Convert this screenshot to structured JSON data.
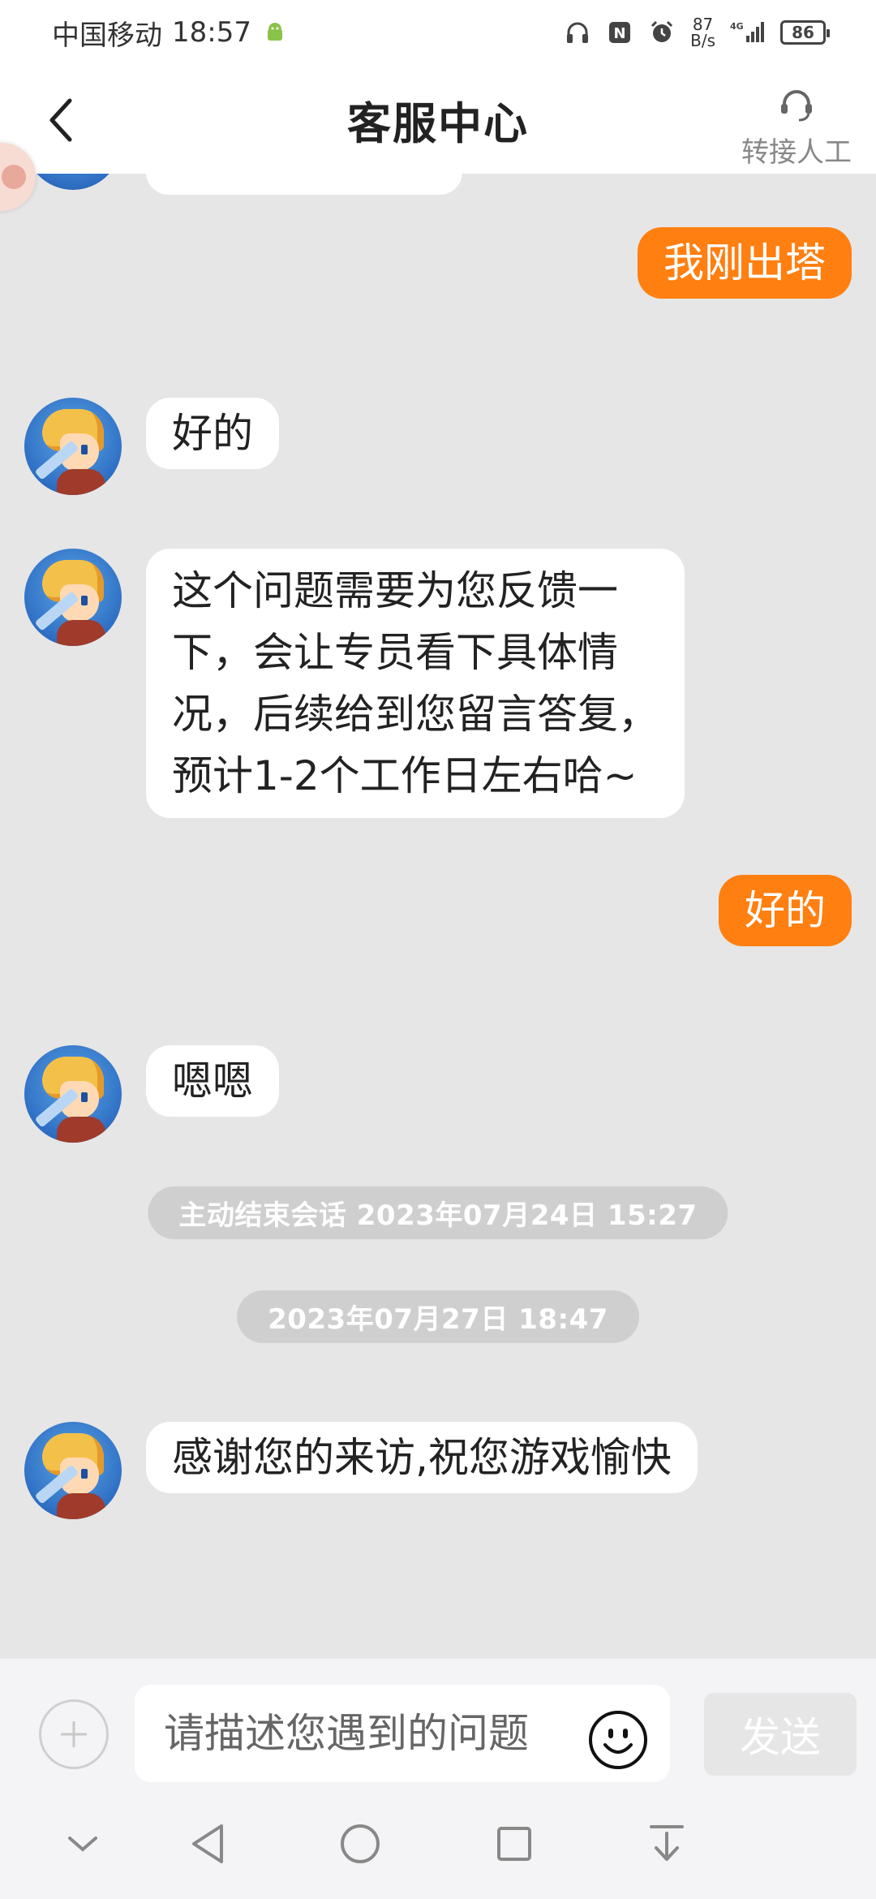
{
  "status_bar": {
    "carrier": "中国移动",
    "time": "18:57",
    "net_speed_value": "87",
    "net_speed_unit": "B/s",
    "battery": "86",
    "signal_type": "4G"
  },
  "header": {
    "title": "客服中心",
    "transfer_label": "转接人工"
  },
  "messages": [
    {
      "from": "user",
      "text": "我刚出塔"
    },
    {
      "from": "agent",
      "text": "好的"
    },
    {
      "from": "agent",
      "lines": [
        "这个问题需要为您反馈一",
        "下，会让专员看下具体情",
        "况，后续给到您留言答复，",
        "预计1-2个工作日左右哈~"
      ]
    },
    {
      "from": "user",
      "text": "好的"
    },
    {
      "from": "agent",
      "text": "嗯嗯"
    },
    {
      "from": "system",
      "text": "主动结束会话 2023年07月24日 15:27"
    },
    {
      "from": "system",
      "text": "2023年07月27日 18:47"
    },
    {
      "from": "agent",
      "text": "感谢您的来访,祝您游戏愉快"
    }
  ],
  "input": {
    "placeholder": "请描述您遇到的问题",
    "send_label": "发送"
  },
  "colors": {
    "accent": "#ff7f11",
    "background": "#e6e6e6",
    "bubble": "#ffffff",
    "timestamp_bg": "#cfcfcf"
  }
}
